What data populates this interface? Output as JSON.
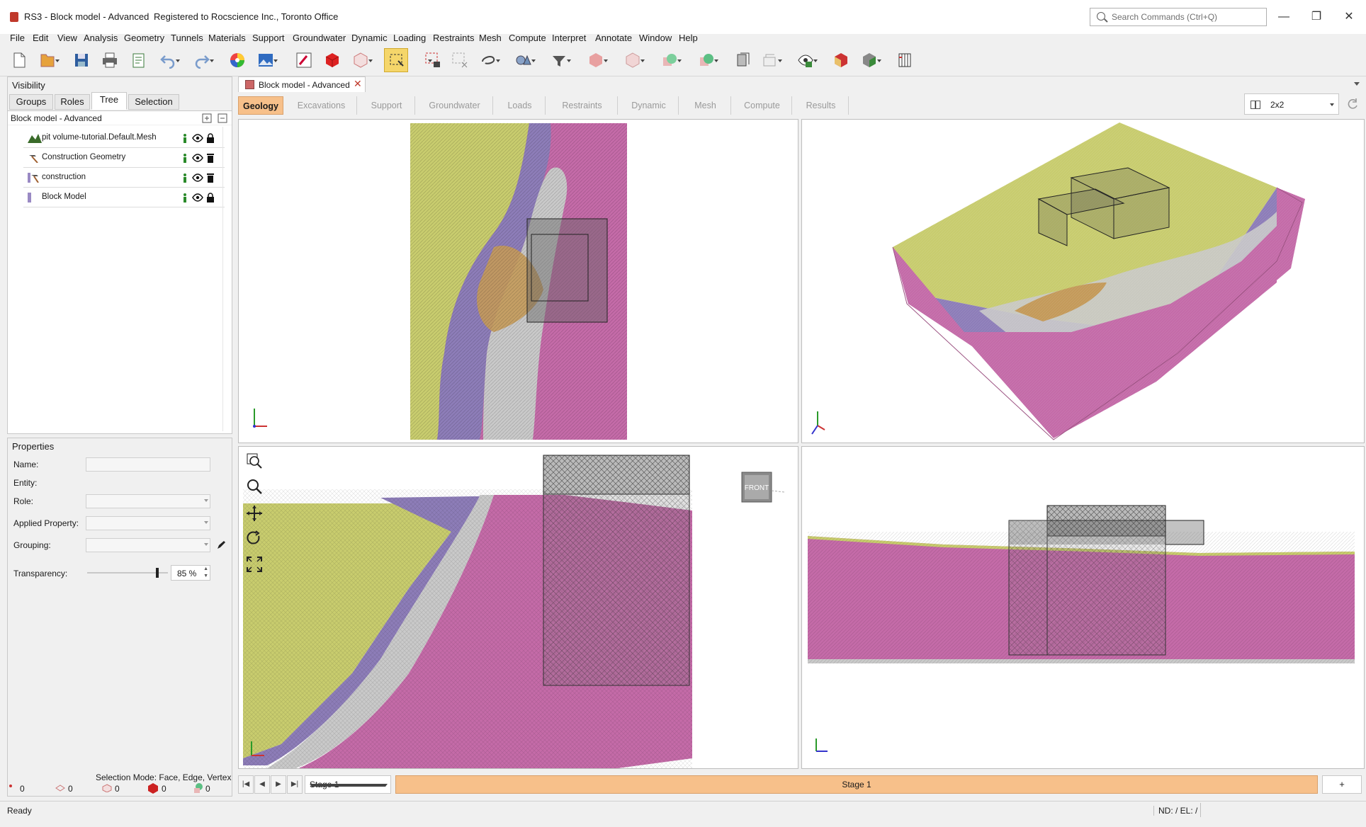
{
  "window": {
    "title": "RS3 - Block model - Advanced",
    "registration": "Registered to Rocscience Inc., Toronto Office",
    "search_placeholder": "Search Commands (Ctrl+Q)"
  },
  "menu": [
    "File",
    "Edit",
    "View",
    "Analysis",
    "Geometry",
    "Tunnels",
    "Materials",
    "Support",
    "Groundwater",
    "Dynamic",
    "Loading",
    "Restraints",
    "Mesh",
    "Compute",
    "Interpret",
    "Annotate",
    "Window",
    "Help"
  ],
  "visibility": {
    "title": "Visibility",
    "tabs": [
      "Groups",
      "Roles",
      "Tree",
      "Selection"
    ],
    "active_tab": "Tree",
    "root": "Block model - Advanced",
    "items": [
      {
        "label": "pit volume-tutorial.Default.Mesh",
        "icon": "mesh-surface-icon"
      },
      {
        "label": "Construction Geometry",
        "icon": "hammer-icon"
      },
      {
        "label": "construction",
        "icon": "construction-icon"
      },
      {
        "label": "Block Model",
        "icon": "block-model-icon"
      }
    ]
  },
  "properties": {
    "title": "Properties",
    "name_label": "Name:",
    "entity_label": "Entity:",
    "role_label": "Role:",
    "applied_property_label": "Applied Property:",
    "grouping_label": "Grouping:",
    "transparency_label": "Transparency:",
    "transparency_value": "85 %",
    "transparency_fraction": 0.85,
    "selection_mode": "Selection Mode: Face, Edge, Vertex",
    "counts": [
      "0",
      "0",
      "0",
      "0",
      "0"
    ]
  },
  "document_tab": "Block model - Advanced",
  "workflow": {
    "tabs": [
      "Geology",
      "Excavations",
      "Support",
      "Groundwater",
      "Loads",
      "Restraints",
      "Dynamic",
      "Mesh",
      "Compute",
      "Results"
    ],
    "active": "Geology"
  },
  "layout": {
    "value": "2x2"
  },
  "viewport": {
    "front_label": "FRONT"
  },
  "stage": {
    "selected": "Stage 1",
    "active_tab": "Stage 1",
    "add_label": "+"
  },
  "status": {
    "ready": "Ready",
    "nd_el": "ND: /  EL: /"
  },
  "colors": {
    "accent": "#f7c08a",
    "geo_yellow": "#c8cc6e",
    "geo_purple": "#8d7db8",
    "geo_pink": "#c46ba8",
    "geo_grey": "#c9c9c9",
    "geo_orange": "#c49a5a"
  }
}
